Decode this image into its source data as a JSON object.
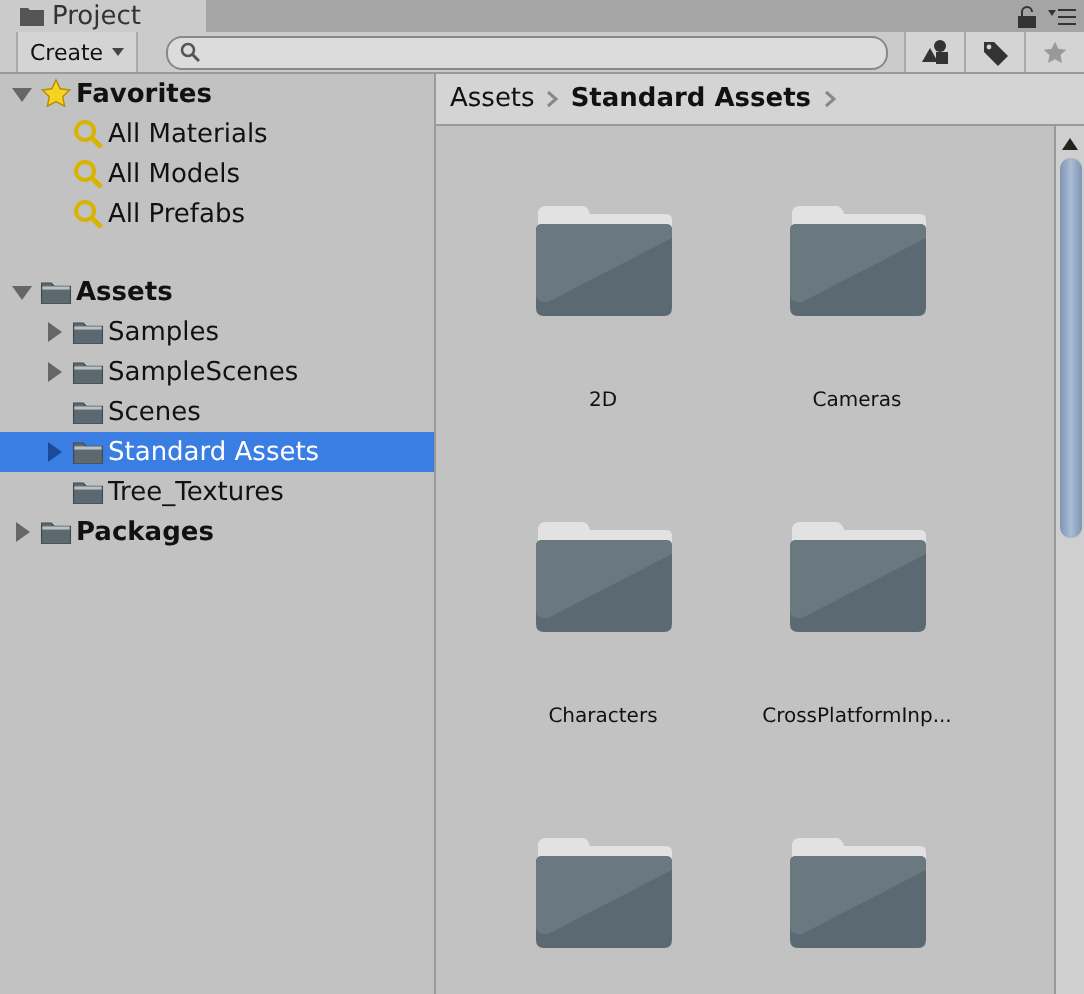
{
  "tab": {
    "title": "Project"
  },
  "toolbar": {
    "create_label": "Create"
  },
  "tree": [
    {
      "label": "Favorites",
      "kind": "favorites",
      "expanded": true,
      "selected": false,
      "children": [
        {
          "label": "All Materials",
          "kind": "search",
          "selected": false
        },
        {
          "label": "All Models",
          "kind": "search",
          "selected": false
        },
        {
          "label": "All Prefabs",
          "kind": "search",
          "selected": false
        }
      ]
    },
    {
      "label": "Assets",
      "kind": "folder",
      "expanded": true,
      "selected": false,
      "children": [
        {
          "label": "Samples",
          "kind": "folder",
          "expandable": true,
          "selected": false
        },
        {
          "label": "SampleScenes",
          "kind": "folder",
          "expandable": true,
          "selected": false
        },
        {
          "label": "Scenes",
          "kind": "folder",
          "expandable": false,
          "selected": false
        },
        {
          "label": "Standard Assets",
          "kind": "folder",
          "expandable": true,
          "selected": true
        },
        {
          "label": "Tree_Textures",
          "kind": "folder",
          "expandable": false,
          "selected": false
        }
      ]
    },
    {
      "label": "Packages",
      "kind": "folder",
      "expanded": false,
      "selected": false
    }
  ],
  "breadcrumb": [
    "Assets",
    "Standard Assets"
  ],
  "grid": [
    {
      "kind": "folder",
      "name": "2D"
    },
    {
      "kind": "folder",
      "name": "Cameras"
    },
    {
      "kind": "folder",
      "name": "Characters"
    },
    {
      "kind": "folder",
      "name": "CrossPlatformInp..."
    },
    {
      "kind": "folder"
    },
    {
      "kind": "folder"
    }
  ]
}
